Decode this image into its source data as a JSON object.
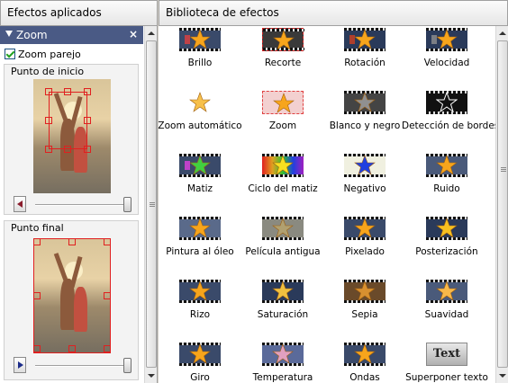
{
  "panels": {
    "left_title": "Efectos aplicados",
    "right_title": "Biblioteca de efectos"
  },
  "applied_effect": {
    "name": "Zoom",
    "close_glyph": "×",
    "smooth_zoom_label": "Zoom parejo",
    "smooth_zoom_checked": true,
    "start_point_label": "Punto de inicio",
    "end_point_label": "Punto final",
    "start_slider_value": 1.0,
    "end_slider_value": 1.0
  },
  "effects": [
    {
      "label": "Brillo",
      "icon": "star-bright-icon"
    },
    {
      "label": "Recorte",
      "icon": "star-crop-icon"
    },
    {
      "label": "Rotación",
      "icon": "star-rotate-icon"
    },
    {
      "label": "Velocidad",
      "icon": "star-speed-icon"
    },
    {
      "label": "Zoom automático",
      "icon": "star-autozoom-icon"
    },
    {
      "label": "Zoom",
      "icon": "star-zoom-icon"
    },
    {
      "label": "Blanco y negro",
      "icon": "star-grayscale-icon"
    },
    {
      "label": "Detección de bordes",
      "icon": "star-edges-icon"
    },
    {
      "label": "Matiz",
      "icon": "star-hue-icon"
    },
    {
      "label": "Ciclo del matiz",
      "icon": "star-hue-cycle-icon"
    },
    {
      "label": "Negativo",
      "icon": "star-negative-icon"
    },
    {
      "label": "Ruido",
      "icon": "star-noise-icon"
    },
    {
      "label": "Pintura al óleo",
      "icon": "star-oil-icon"
    },
    {
      "label": "Película antigua",
      "icon": "star-old-film-icon"
    },
    {
      "label": "Pixelado",
      "icon": "star-pixelate-icon"
    },
    {
      "label": "Posterización",
      "icon": "star-posterize-icon"
    },
    {
      "label": "Rizo",
      "icon": "star-ripple-icon"
    },
    {
      "label": "Saturación",
      "icon": "star-saturation-icon"
    },
    {
      "label": "Sepia",
      "icon": "star-sepia-icon"
    },
    {
      "label": "Suavidad",
      "icon": "star-soften-icon"
    },
    {
      "label": "Giro",
      "icon": "star-twirl-icon"
    },
    {
      "label": "Temperatura",
      "icon": "star-temperature-icon"
    },
    {
      "label": "Ondas",
      "icon": "star-waves-icon"
    },
    {
      "label": "Superponer texto",
      "icon": "text-overlay-icon",
      "icon_text": "Text"
    }
  ],
  "colors": {
    "zoom_bar": "#4a5a85",
    "star": "#f7a51c",
    "selection": "#e02020"
  }
}
